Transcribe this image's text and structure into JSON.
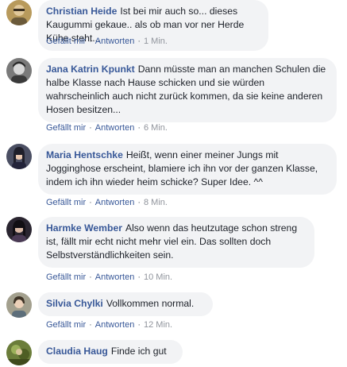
{
  "comments": [
    {
      "author": "Christian Heide",
      "text": "Ist bei mir auch so... dieses Kaugummi gekaue.. als ob man vor ner Herde Kühe steht...",
      "like_label": "Gefällt mir",
      "reply_label": "Antworten",
      "time": "1 Min."
    },
    {
      "author": "Jana Katrin Kpunkt",
      "text": "Dann müsste man an manchen Schulen die halbe Klasse nach Hause schicken und sie würden wahrscheinlich auch nicht zurück kommen, da sie keine anderen Hosen besitzen...",
      "like_label": "Gefällt mir",
      "reply_label": "Antworten",
      "time": "6 Min."
    },
    {
      "author": "Maria Hentschke",
      "text": "Heißt, wenn einer meiner Jungs mit Jogginghose erscheint, blamiere ich ihn vor der ganzen Klasse, indem ich ihn wieder heim schicke? Super Idee. ^^",
      "like_label": "Gefällt mir",
      "reply_label": "Antworten",
      "time": "8 Min."
    },
    {
      "author": "Harmke Wember",
      "text": "Also wenn das heutzutage schon streng ist, fällt mir echt nicht mehr viel ein. Das sollten doch Selbstverständlichkeiten sein.",
      "like_label": "Gefällt mir",
      "reply_label": "Antworten",
      "time": "10 Min."
    },
    {
      "author": "Silvia Chylki",
      "text": "Vollkommen normal.",
      "like_label": "Gefällt mir",
      "reply_label": "Antworten",
      "time": "12 Min."
    },
    {
      "author": "Claudia Haug",
      "text": "Finde ich gut"
    }
  ],
  "colors": {
    "author": "#385898",
    "bubble": "#f2f3f5",
    "meta": "#606770"
  }
}
